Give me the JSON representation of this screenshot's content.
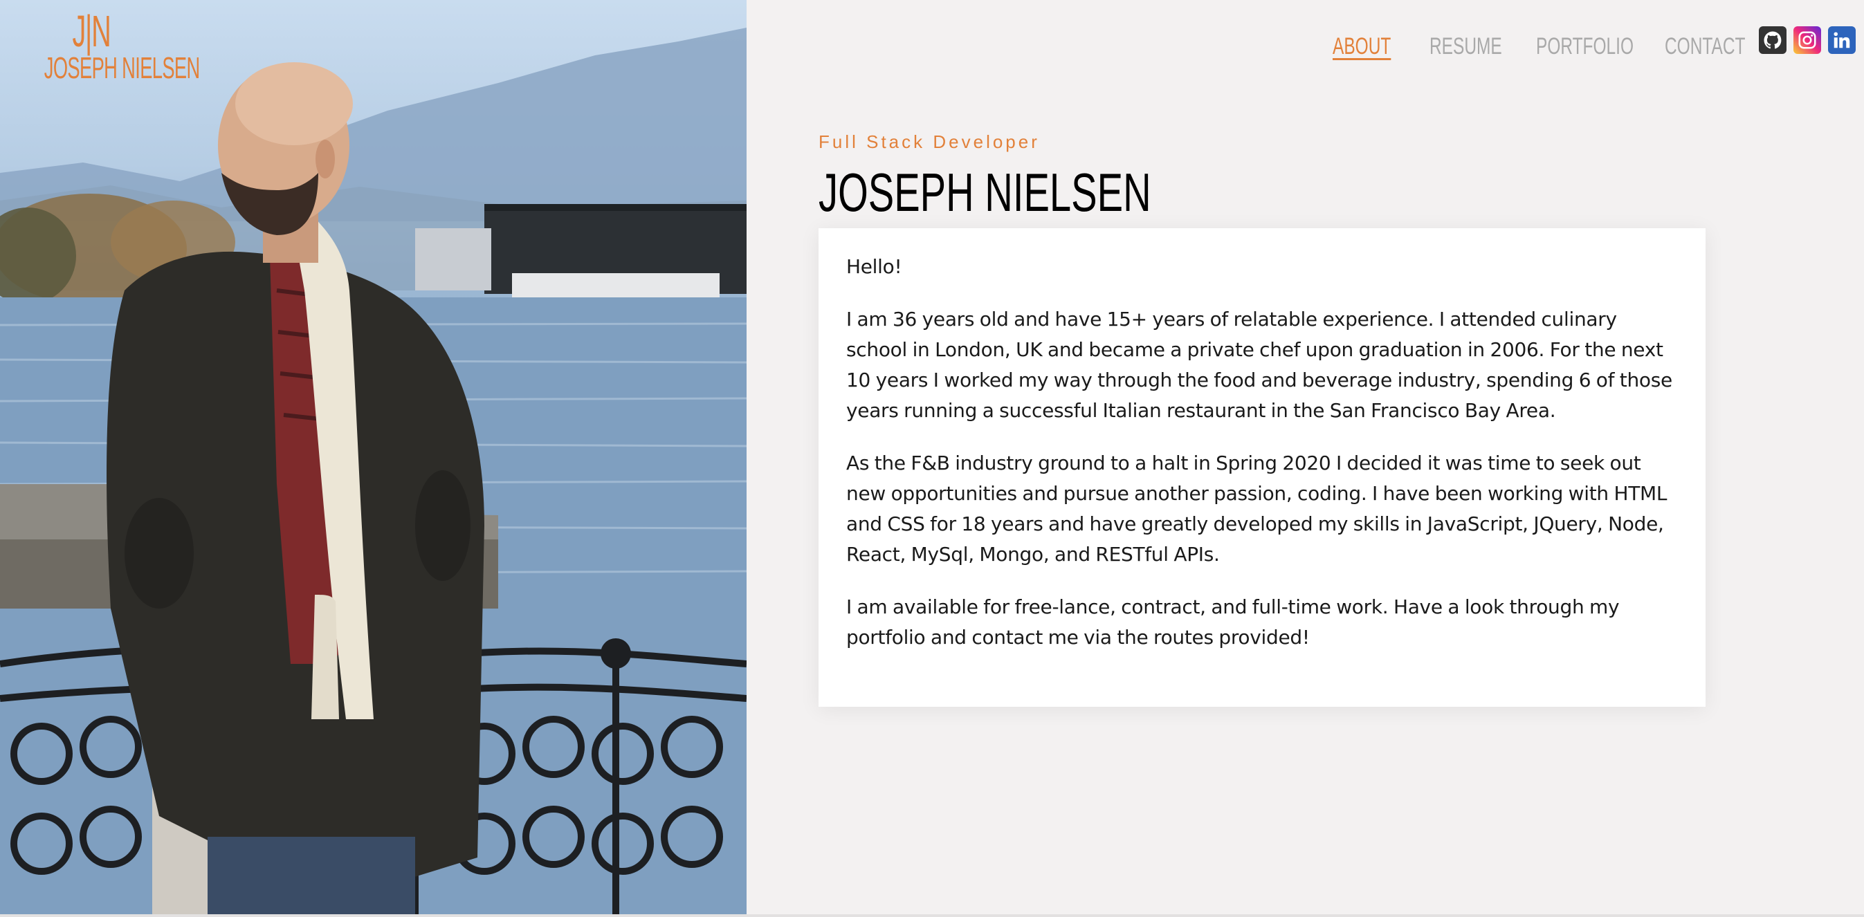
{
  "brand": {
    "monogram": "J|N",
    "name": "JOSEPH NIELSEN"
  },
  "nav": {
    "items": [
      {
        "label": "ABOUT",
        "active": true
      },
      {
        "label": "RESUME",
        "active": false
      },
      {
        "label": "PORTFOLIO",
        "active": false
      },
      {
        "label": "CONTACT",
        "active": false
      }
    ]
  },
  "socials": [
    {
      "icon": "github-icon",
      "color": "#333333"
    },
    {
      "icon": "instagram-icon",
      "color": "#ee2a7b"
    },
    {
      "icon": "linkedin-icon",
      "color": "#2d64bc"
    }
  ],
  "about": {
    "tagline": "Full Stack Developer",
    "headline": "JOSEPH NIELSEN",
    "paragraphs": [
      "Hello!",
      "I am 36 years old and have 15+ years of relatable experience. I attended culinary school in London, UK and became a private chef upon graduation in 2006. For the next 10 years I worked my way through the food and beverage industry, spending 6 of those years running a successful Italian restaurant in the San Francisco Bay Area.",
      "As the F&B industry ground to a halt in Spring 2020 I decided it was time to seek out new opportunities and pursue another passion, coding. I have been working with HTML and CSS for 18 years and have greatly developed my skills in JavaScript, JQuery, Node, React, MySql, Mongo, and RESTful APIs.",
      "I am available for free-lance, contract, and full-time work. Have a look through my portfolio and contact me via the routes provided!"
    ]
  },
  "colors": {
    "accent": "#e2813a",
    "nav_inactive": "#a9a9a9",
    "background": "#f3f1f1",
    "card": "#ffffff"
  }
}
